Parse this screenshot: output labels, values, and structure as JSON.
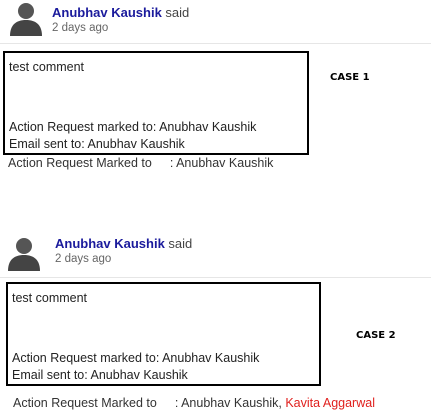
{
  "cases": [
    {
      "author": "Anubhav Kaushik",
      "said": "said",
      "timestamp": "2 days ago",
      "comment": "test comment",
      "action_request_line": "Action Request marked to: Anubhav Kaushik",
      "email_line": "Email sent to: Anubhav Kaushik",
      "case_label": "CASE 1",
      "summary_label": "Action Request Marked to",
      "summary_value": ": Anubhav Kaushik",
      "summary_extra": ""
    },
    {
      "author": "Anubhav Kaushik",
      "said": "said",
      "timestamp": "2 days ago",
      "comment": "test comment",
      "action_request_line": "Action Request marked to: Anubhav Kaushik",
      "email_line": "Email sent to: Anubhav Kaushik",
      "case_label": "CASE 2",
      "summary_label": "Action Request Marked to",
      "summary_value": ": Anubhav Kaushik,",
      "summary_extra": "Kavita Aggarwal"
    }
  ],
  "colors": {
    "author_link": "#1a1a9c",
    "extra_name": "#e0201e",
    "box_border": "#000000"
  },
  "icons": {
    "avatar": "user-silhouette-icon"
  }
}
